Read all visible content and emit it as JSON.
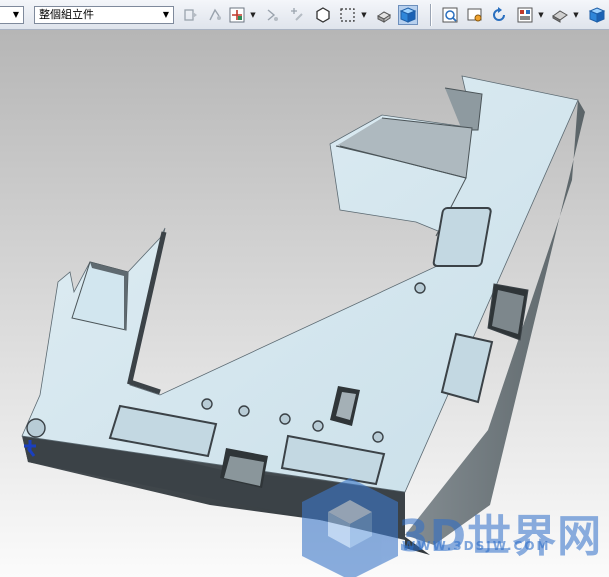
{
  "toolbar": {
    "left_combo": {
      "value": ""
    },
    "filter_combo": {
      "value": "整個組立件"
    },
    "icons": [
      "selection-filter-icon",
      "snap-point-icon",
      "point-on-face-icon",
      "quick-pick-icon",
      "select-all-icon",
      "select-vertex-icon",
      "rectangle-select-icon",
      "select-solid-icon",
      "3d-cube-icon",
      "fit-view-icon",
      "zoom-icon",
      "rotate-icon",
      "layout-icon",
      "render-style-icon",
      "shaded-cube-icon"
    ]
  },
  "watermark": {
    "logo_text": "3D世界网",
    "url": "WWW.3DSJW.COM"
  },
  "colors": {
    "part_top": "#d2e6ef",
    "part_side_dark": "#3b4247",
    "part_side_light": "#6f787c",
    "viewport_top": "#b6b6b6",
    "viewport_bottom": "#fbfbfb",
    "watermark": "#2d6ec8"
  }
}
